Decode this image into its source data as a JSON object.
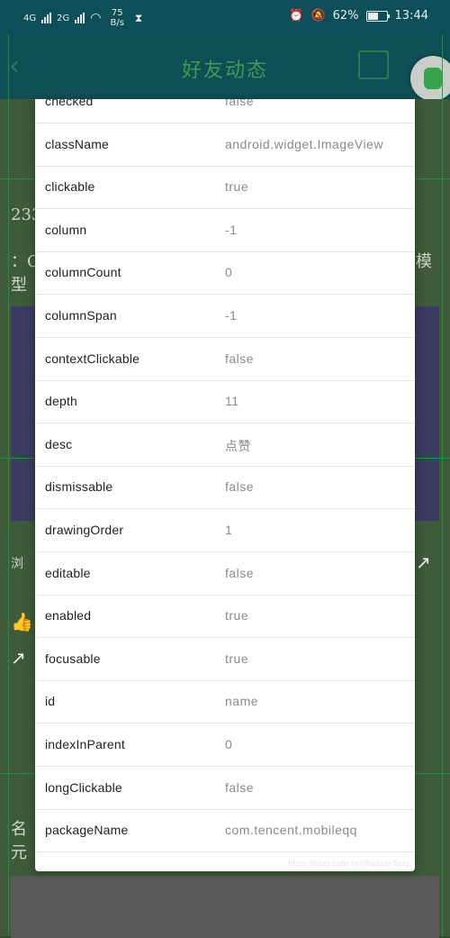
{
  "status_bar": {
    "net1": "4G",
    "net2": "2G",
    "speed_value": "75",
    "speed_unit": "B/s",
    "battery": "62%",
    "battery_level": 0.62,
    "time": "13:44"
  },
  "app_header": {
    "title": "好友动态"
  },
  "background": {
    "frag1": "233",
    "frag2": "：C",
    "frag3": "型",
    "frag4": "模",
    "frag5": "浏",
    "frag6": "名",
    "frag7": "元"
  },
  "properties": [
    {
      "key": "checked",
      "value": "false"
    },
    {
      "key": "className",
      "value": "android.widget.ImageView"
    },
    {
      "key": "clickable",
      "value": "true"
    },
    {
      "key": "column",
      "value": "-1"
    },
    {
      "key": "columnCount",
      "value": "0"
    },
    {
      "key": "columnSpan",
      "value": "-1"
    },
    {
      "key": "contextClickable",
      "value": "false"
    },
    {
      "key": "depth",
      "value": "11"
    },
    {
      "key": "desc",
      "value": "点赞"
    },
    {
      "key": "dismissable",
      "value": "false"
    },
    {
      "key": "drawingOrder",
      "value": "1"
    },
    {
      "key": "editable",
      "value": "false"
    },
    {
      "key": "enabled",
      "value": "true"
    },
    {
      "key": "focusable",
      "value": "true"
    },
    {
      "key": "id",
      "value": "name"
    },
    {
      "key": "indexInParent",
      "value": "0"
    },
    {
      "key": "longClickable",
      "value": "false"
    },
    {
      "key": "packageName",
      "value": "com.tencent.mobileqq"
    }
  ],
  "watermark": "https://blog.csdn.net/RadiumTang"
}
